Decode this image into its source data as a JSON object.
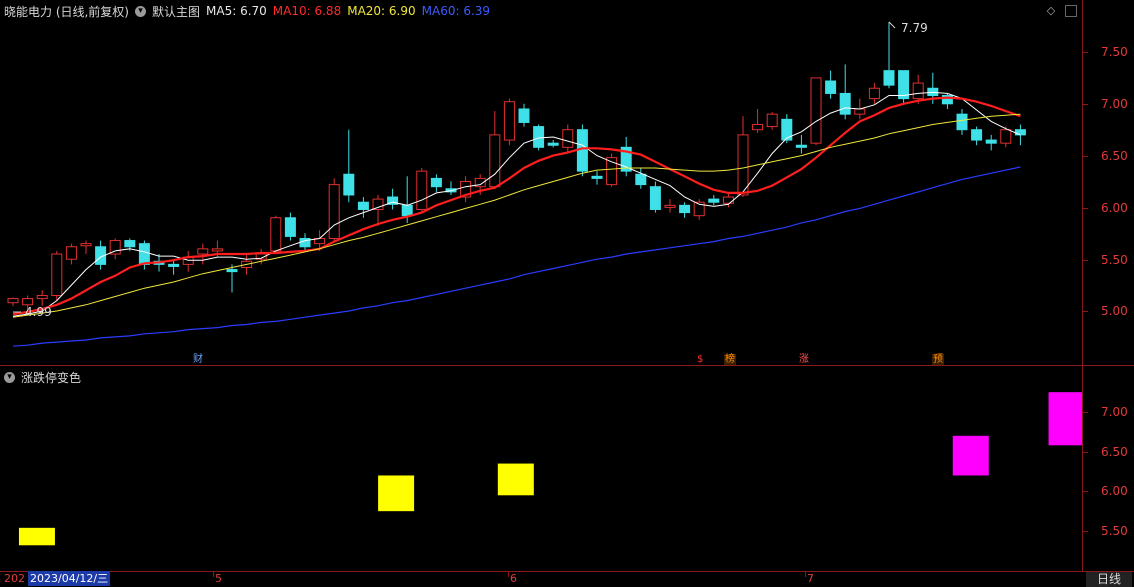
{
  "header": {
    "stock_title": "晓能电力 (日线,前复权)",
    "template_label": "默认主图",
    "ma5": "MA5: 6.70",
    "ma10": "MA10: 6.88",
    "ma20": "MA20: 6.90",
    "ma60": "MA60: 6.39"
  },
  "colors": {
    "up": "#e03030",
    "down": "#3fe0e8",
    "ma5": "#ffffff",
    "ma10": "#ff1e1e",
    "ma20": "#f0e63a",
    "ma60": "#2a3cff",
    "limit_up": "#ff00ff",
    "limit_down": "#ffff00"
  },
  "annotations": {
    "high": "7.79",
    "low": "4.99"
  },
  "events": [
    "财",
    "$",
    "榜",
    "涨",
    "预"
  ],
  "y_axis_main": [
    "7.50",
    "7.00",
    "6.50",
    "6.00",
    "5.50",
    "5.00"
  ],
  "sub_panel": {
    "title": "涨跌停变色",
    "y_axis": [
      "7.00",
      "6.50",
      "6.00",
      "5.50"
    ]
  },
  "x_axis": {
    "partial": "202",
    "selected_date": "2023/04/12/三",
    "months": [
      "5",
      "6",
      "7"
    ]
  },
  "period_label": "日线",
  "chart_data": {
    "type": "candlestick",
    "ylim": [
      4.58,
      7.95
    ],
    "candles": [
      [
        5.08,
        5.12,
        5.05,
        5.13
      ],
      [
        5.06,
        5.12,
        5.0,
        5.15
      ],
      [
        5.12,
        5.15,
        5.05,
        5.2
      ],
      [
        5.15,
        5.55,
        5.1,
        5.58
      ],
      [
        5.5,
        5.62,
        5.45,
        5.65
      ],
      [
        5.63,
        5.65,
        5.55,
        5.68
      ],
      [
        5.62,
        5.45,
        5.4,
        5.68
      ],
      [
        5.55,
        5.68,
        5.5,
        5.7
      ],
      [
        5.68,
        5.62,
        5.58,
        5.7
      ],
      [
        5.65,
        5.45,
        5.4,
        5.68
      ],
      [
        5.48,
        5.45,
        5.38,
        5.55
      ],
      [
        5.45,
        5.43,
        5.35,
        5.5
      ],
      [
        5.45,
        5.52,
        5.38,
        5.58
      ],
      [
        5.55,
        5.6,
        5.45,
        5.65
      ],
      [
        5.58,
        5.6,
        5.52,
        5.68
      ],
      [
        5.4,
        5.38,
        5.18,
        5.45
      ],
      [
        5.42,
        5.48,
        5.35,
        5.55
      ],
      [
        5.5,
        5.55,
        5.45,
        5.6
      ],
      [
        5.58,
        5.9,
        5.55,
        5.92
      ],
      [
        5.9,
        5.72,
        5.68,
        5.95
      ],
      [
        5.7,
        5.62,
        5.58,
        5.75
      ],
      [
        5.65,
        5.7,
        5.58,
        5.78
      ],
      [
        5.7,
        6.22,
        5.68,
        6.28
      ],
      [
        6.32,
        6.12,
        6.05,
        6.75
      ],
      [
        6.05,
        5.98,
        5.9,
        6.1
      ],
      [
        5.98,
        6.08,
        5.82,
        6.12
      ],
      [
        6.1,
        6.03,
        5.98,
        6.18
      ],
      [
        6.02,
        5.92,
        5.85,
        6.3
      ],
      [
        5.98,
        6.35,
        5.95,
        6.38
      ],
      [
        6.28,
        6.2,
        6.15,
        6.32
      ],
      [
        6.18,
        6.15,
        6.12,
        6.25
      ],
      [
        6.1,
        6.25,
        6.05,
        6.3
      ],
      [
        6.2,
        6.28,
        6.12,
        6.32
      ],
      [
        6.2,
        6.7,
        6.18,
        6.93
      ],
      [
        6.65,
        7.02,
        6.6,
        7.05
      ],
      [
        6.95,
        6.82,
        6.78,
        7.0
      ],
      [
        6.78,
        6.58,
        6.55,
        6.8
      ],
      [
        6.62,
        6.6,
        6.58,
        6.65
      ],
      [
        6.58,
        6.75,
        6.52,
        6.8
      ],
      [
        6.75,
        6.35,
        6.3,
        6.8
      ],
      [
        6.3,
        6.28,
        6.22,
        6.35
      ],
      [
        6.22,
        6.48,
        6.2,
        6.52
      ],
      [
        6.58,
        6.35,
        6.3,
        6.68
      ],
      [
        6.32,
        6.22,
        6.18,
        6.38
      ],
      [
        6.2,
        5.98,
        5.95,
        6.25
      ],
      [
        6.0,
        6.02,
        5.95,
        6.08
      ],
      [
        6.02,
        5.95,
        5.9,
        6.05
      ],
      [
        5.92,
        6.05,
        5.88,
        6.08
      ],
      [
        6.08,
        6.05,
        6.02,
        6.12
      ],
      [
        6.04,
        6.1,
        6.0,
        6.15
      ],
      [
        6.12,
        6.7,
        6.1,
        6.88
      ],
      [
        6.75,
        6.8,
        6.72,
        6.95
      ],
      [
        6.78,
        6.9,
        6.75,
        6.92
      ],
      [
        6.85,
        6.65,
        6.62,
        6.9
      ],
      [
        6.6,
        6.58,
        6.52,
        6.7
      ],
      [
        6.62,
        7.25,
        6.6,
        7.25
      ],
      [
        7.22,
        7.1,
        7.05,
        7.32
      ],
      [
        7.1,
        6.9,
        6.85,
        7.38
      ],
      [
        6.9,
        6.95,
        6.85,
        7.05
      ],
      [
        7.05,
        7.15,
        7.0,
        7.2
      ],
      [
        7.32,
        7.18,
        7.15,
        7.79
      ],
      [
        7.32,
        7.05,
        7.0,
        7.32
      ],
      [
        7.05,
        7.2,
        7.0,
        7.28
      ],
      [
        7.15,
        7.08,
        7.0,
        7.3
      ],
      [
        7.08,
        7.0,
        6.95,
        7.1
      ],
      [
        6.9,
        6.75,
        6.7,
        6.95
      ],
      [
        6.75,
        6.65,
        6.6,
        6.78
      ],
      [
        6.65,
        6.62,
        6.55,
        6.7
      ],
      [
        6.62,
        6.75,
        6.58,
        6.78
      ],
      [
        6.75,
        6.7,
        6.6,
        6.8
      ]
    ],
    "ma_series": [
      {
        "name": "MA5",
        "values": [
          4.95,
          4.97,
          5.0,
          5.1,
          5.25,
          5.4,
          5.52,
          5.58,
          5.6,
          5.57,
          5.53,
          5.53,
          5.49,
          5.49,
          5.52,
          5.52,
          5.5,
          5.51,
          5.58,
          5.63,
          5.68,
          5.7,
          5.83,
          5.9,
          5.95,
          6.0,
          6.05,
          6.02,
          6.07,
          6.14,
          6.16,
          6.2,
          6.22,
          6.32,
          6.48,
          6.62,
          6.67,
          6.68,
          6.64,
          6.6,
          6.5,
          6.44,
          6.39,
          6.33,
          6.27,
          6.21,
          6.1,
          6.03,
          6.01,
          6.03,
          6.15,
          6.33,
          6.52,
          6.67,
          6.73,
          6.83,
          6.91,
          6.96,
          6.95,
          6.99,
          7.08,
          7.08,
          7.1,
          7.11,
          7.1,
          7.05,
          6.94,
          6.83,
          6.76,
          6.7
        ]
      },
      {
        "name": "MA10",
        "values": [
          4.97,
          4.99,
          5.02,
          5.06,
          5.12,
          5.2,
          5.28,
          5.34,
          5.42,
          5.46,
          5.47,
          5.49,
          5.52,
          5.53,
          5.55,
          5.55,
          5.55,
          5.56,
          5.56,
          5.57,
          5.58,
          5.6,
          5.67,
          5.73,
          5.79,
          5.84,
          5.88,
          5.91,
          5.95,
          6.02,
          6.07,
          6.12,
          6.16,
          6.19,
          6.28,
          6.38,
          6.45,
          6.5,
          6.53,
          6.57,
          6.57,
          6.56,
          6.54,
          6.51,
          6.44,
          6.37,
          6.3,
          6.23,
          6.17,
          6.14,
          6.14,
          6.16,
          6.21,
          6.29,
          6.37,
          6.48,
          6.6,
          6.72,
          6.83,
          6.89,
          6.96,
          7.0,
          7.03,
          7.05,
          7.06,
          7.05,
          7.02,
          6.98,
          6.93,
          6.88
        ]
      },
      {
        "name": "MA20",
        "values": [
          4.94,
          4.96,
          4.98,
          5.0,
          5.03,
          5.06,
          5.1,
          5.14,
          5.18,
          5.22,
          5.25,
          5.28,
          5.32,
          5.36,
          5.39,
          5.42,
          5.45,
          5.48,
          5.51,
          5.54,
          5.57,
          5.6,
          5.64,
          5.68,
          5.71,
          5.75,
          5.79,
          5.83,
          5.87,
          5.91,
          5.95,
          5.99,
          6.03,
          6.07,
          6.12,
          6.17,
          6.21,
          6.25,
          6.29,
          6.33,
          6.36,
          6.37,
          6.38,
          6.38,
          6.38,
          6.37,
          6.36,
          6.35,
          6.35,
          6.36,
          6.38,
          6.41,
          6.44,
          6.47,
          6.5,
          6.54,
          6.58,
          6.61,
          6.64,
          6.67,
          6.71,
          6.74,
          6.77,
          6.8,
          6.82,
          6.84,
          6.86,
          6.88,
          6.89,
          6.9
        ]
      },
      {
        "name": "MA60",
        "values": [
          4.66,
          4.67,
          4.69,
          4.7,
          4.71,
          4.72,
          4.74,
          4.75,
          4.76,
          4.78,
          4.79,
          4.8,
          4.82,
          4.83,
          4.84,
          4.86,
          4.87,
          4.89,
          4.9,
          4.92,
          4.94,
          4.96,
          4.98,
          5.0,
          5.03,
          5.05,
          5.08,
          5.1,
          5.13,
          5.16,
          5.19,
          5.22,
          5.25,
          5.28,
          5.31,
          5.35,
          5.38,
          5.41,
          5.44,
          5.47,
          5.5,
          5.52,
          5.55,
          5.57,
          5.59,
          5.61,
          5.63,
          5.65,
          5.67,
          5.7,
          5.72,
          5.75,
          5.78,
          5.81,
          5.85,
          5.88,
          5.92,
          5.96,
          5.99,
          6.03,
          6.07,
          6.11,
          6.15,
          6.19,
          6.23,
          6.27,
          6.3,
          6.33,
          6.36,
          6.39
        ]
      }
    ],
    "sub_chart": {
      "ylim": [
        5.2,
        7.5
      ],
      "blocks": [
        {
          "index": 1,
          "low": 5.32,
          "high": 5.54,
          "color": "limit_down"
        },
        {
          "index": 16,
          "low": 5.75,
          "high": 6.2,
          "color": "limit_down"
        },
        {
          "index": 21,
          "low": 5.95,
          "high": 6.35,
          "color": "limit_down"
        },
        {
          "index": 40,
          "low": 6.2,
          "high": 6.7,
          "color": "limit_up"
        },
        {
          "index": 44,
          "low": 6.58,
          "high": 7.25,
          "color": "limit_up"
        }
      ]
    }
  }
}
